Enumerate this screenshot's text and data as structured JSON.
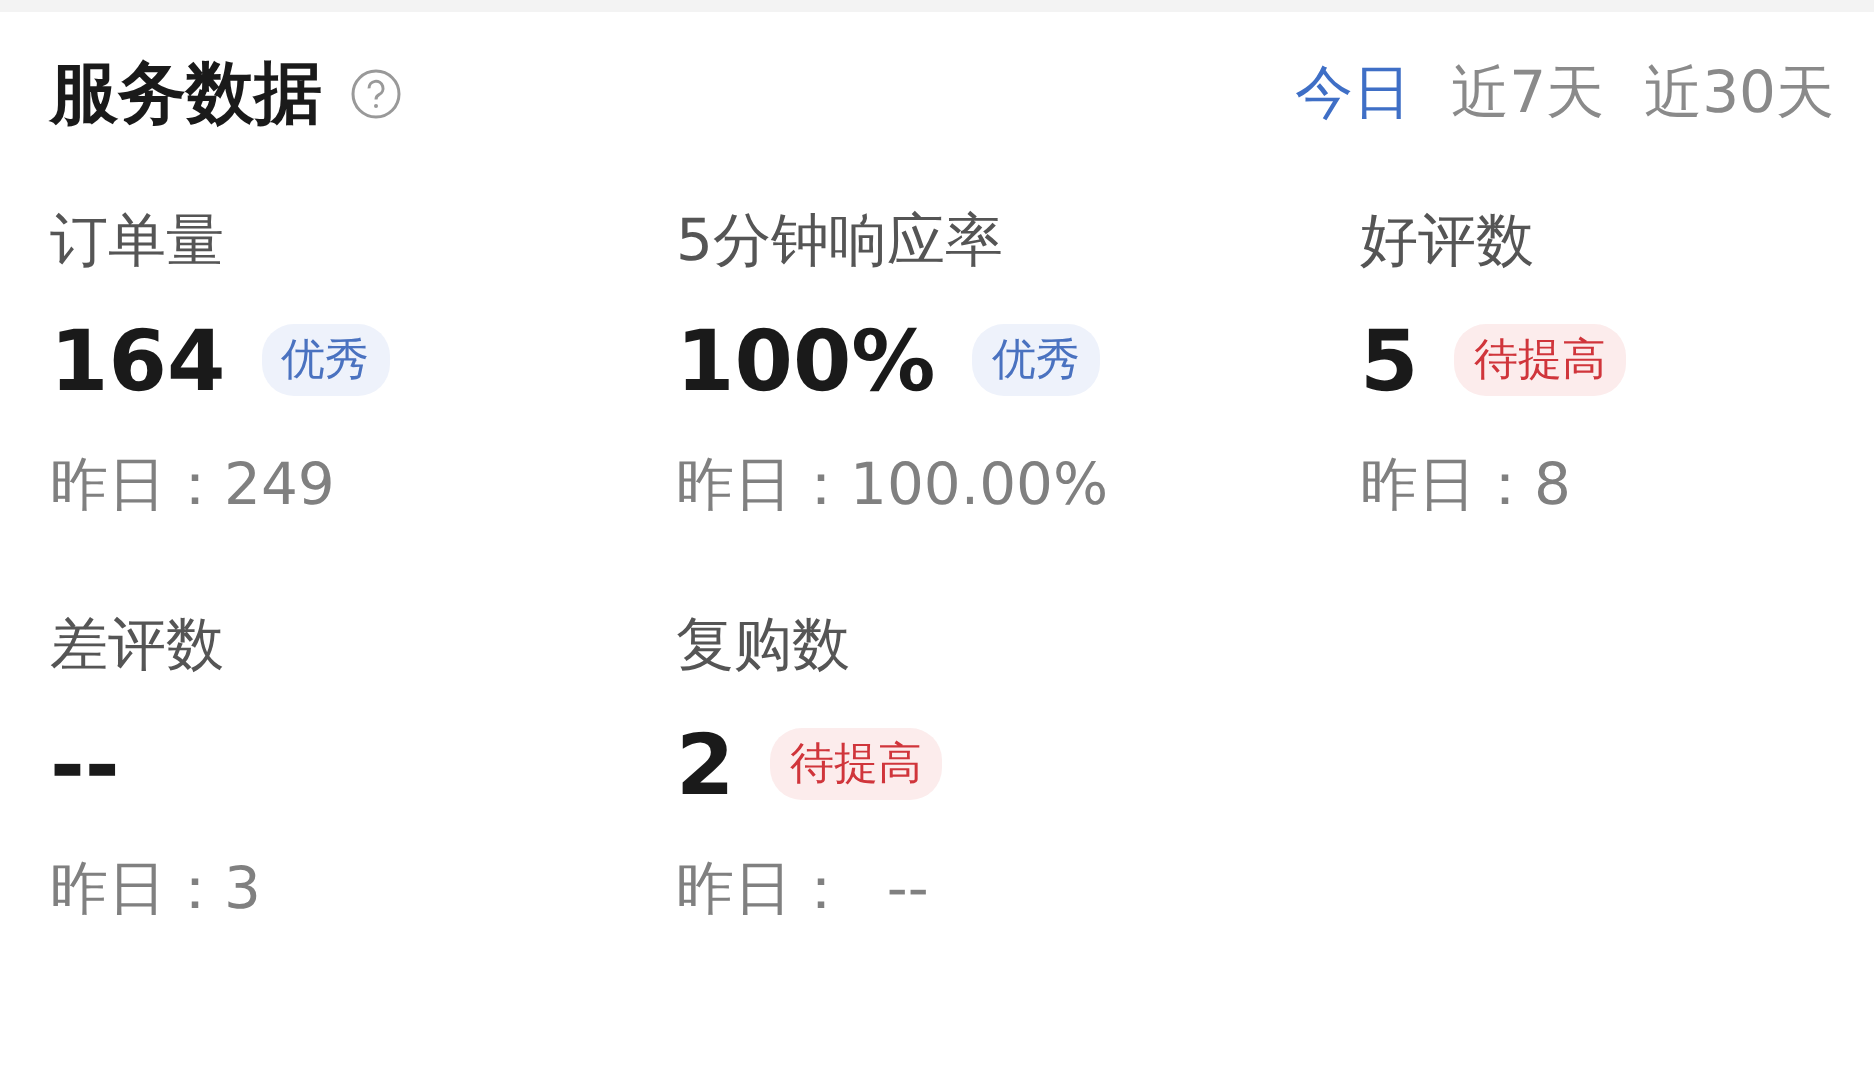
{
  "title": "服务数据",
  "tabs": [
    {
      "label": "今日",
      "selected": true
    },
    {
      "label": "近7天",
      "selected": false
    },
    {
      "label": "近30天",
      "selected": false
    }
  ],
  "metrics": [
    {
      "label": "订单量",
      "value": "164",
      "badge": {
        "text": "优秀",
        "kind": "good"
      },
      "yesterday": "昨日：249"
    },
    {
      "label": "5分钟响应率",
      "value": "100%",
      "badge": {
        "text": "优秀",
        "kind": "good"
      },
      "yesterday": "昨日：100.00%"
    },
    {
      "label": "好评数",
      "value": "5",
      "badge": {
        "text": "待提高",
        "kind": "improve"
      },
      "yesterday": "昨日：8"
    },
    {
      "label": "差评数",
      "value": "--",
      "yesterday": "昨日：3"
    },
    {
      "label": "复购数",
      "value": "2",
      "badge": {
        "text": "待提高",
        "kind": "improve"
      },
      "yesterday": "昨日：  --"
    }
  ]
}
